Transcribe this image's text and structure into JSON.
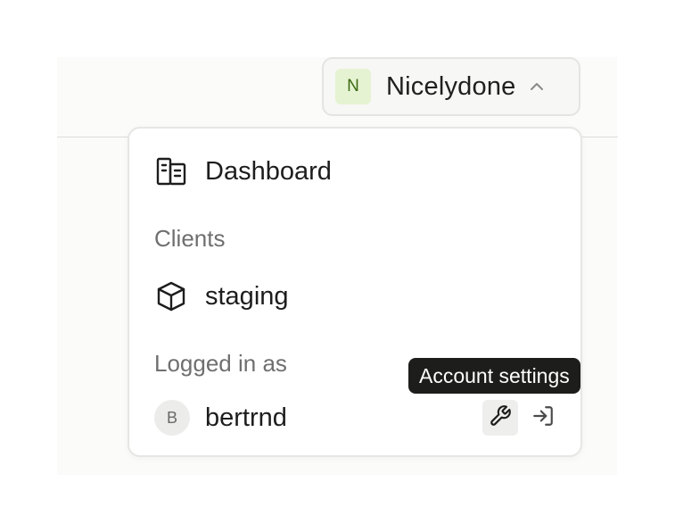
{
  "org": {
    "initial": "N",
    "name": "Nicelydone"
  },
  "menu": {
    "dashboard_label": "Dashboard",
    "clients_heading": "Clients",
    "clients": [
      {
        "label": "staging"
      }
    ],
    "logged_in_heading": "Logged in as",
    "user": {
      "initial": "B",
      "name": "bertrnd"
    }
  },
  "tooltip": {
    "text": "Account settings"
  },
  "icons": {
    "dashboard": "building-icon",
    "client": "cube-icon",
    "settings": "wrench-icon",
    "logout": "log-in-icon",
    "chevron": "chevron-up-icon"
  },
  "colors": {
    "org_avatar_bg": "#e6f3d2",
    "org_avatar_fg": "#3b6a14",
    "tooltip_bg": "#1d1d1b"
  }
}
